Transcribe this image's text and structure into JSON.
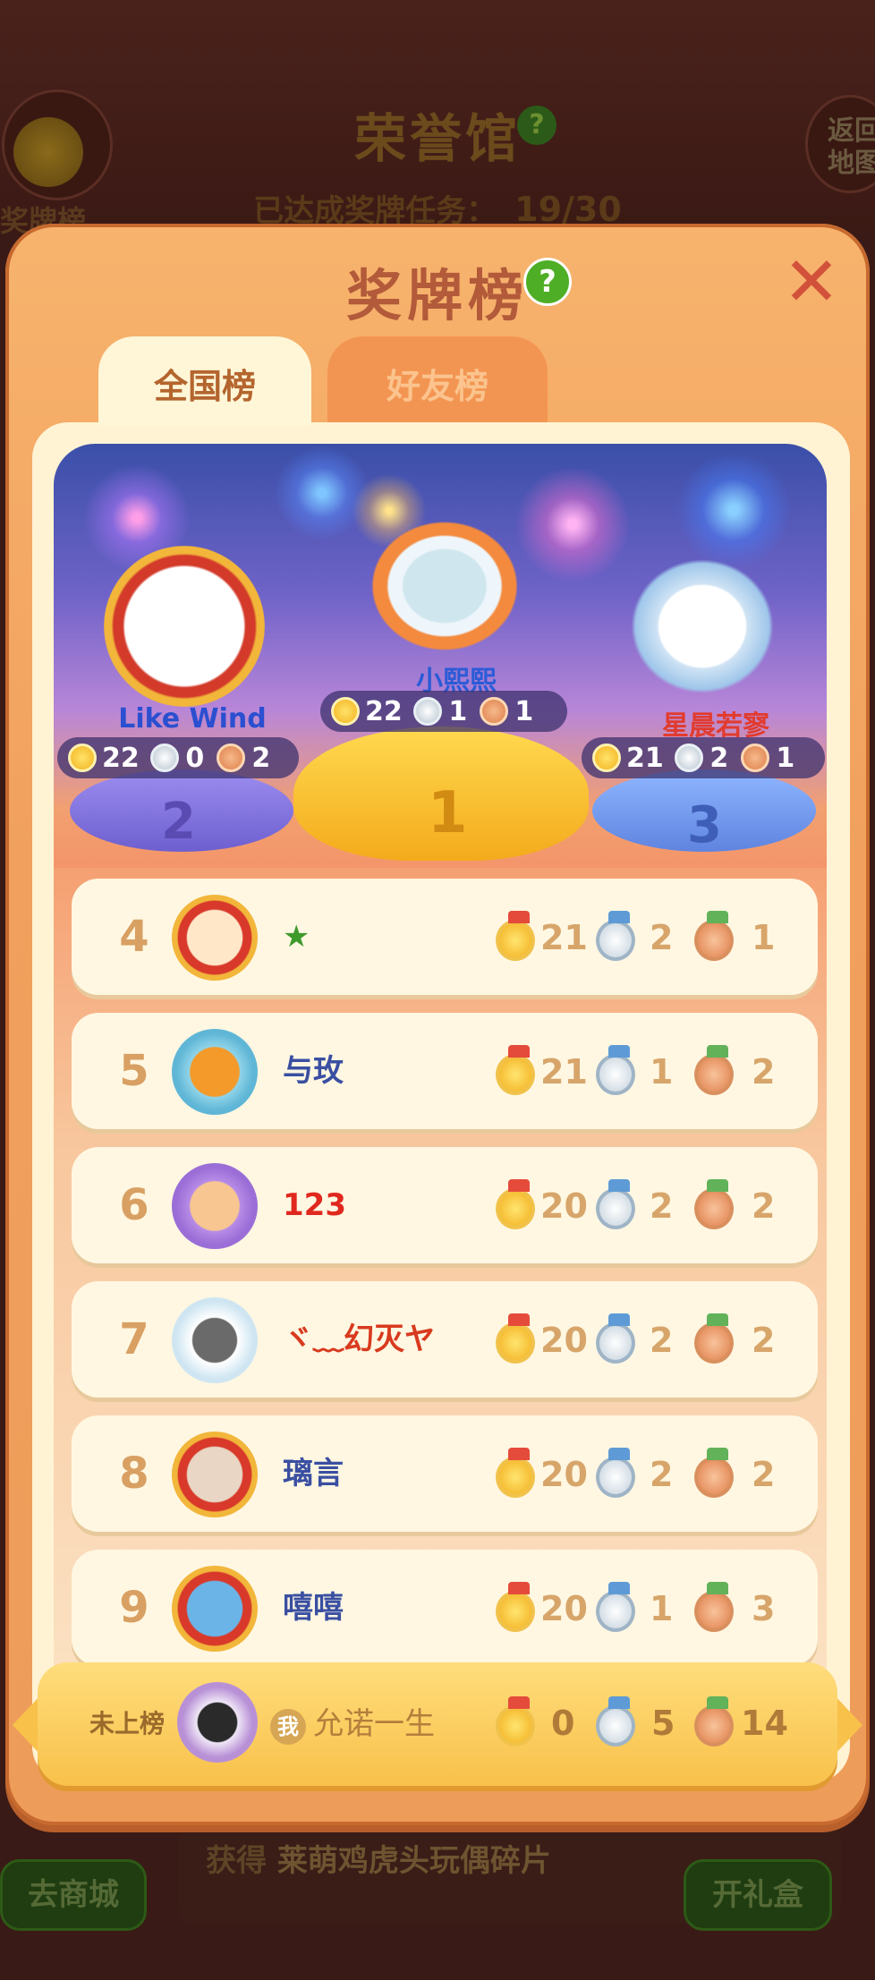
{
  "background": {
    "hall_title": "荣誉馆",
    "hall_help": "?",
    "progress_label": "已达成奖牌任务：",
    "progress_value": "19/30",
    "medal_button_label": "奖牌榜",
    "back_button_label": "返回地图",
    "reward_prefix": "获得",
    "reward_item": "莱萌鸡虎头玩偶碎片",
    "shop_button": "去商城",
    "gift_button": "开礼盒"
  },
  "modal": {
    "title": "奖牌榜",
    "help": "?",
    "close": "✕",
    "tabs": [
      {
        "label": "全国榜",
        "active": true
      },
      {
        "label": "好友榜",
        "active": false
      }
    ]
  },
  "podium": [
    {
      "rank": "1",
      "name": "小熙熙",
      "gold": "22",
      "silver": "1",
      "bronze": "1",
      "name_color": "#2a5bd7"
    },
    {
      "rank": "2",
      "name": "Like Wind",
      "gold": "22",
      "silver": "0",
      "bronze": "2",
      "name_color": "#2a4fd0"
    },
    {
      "rank": "3",
      "name": "星晨若寥",
      "gold": "21",
      "silver": "2",
      "bronze": "1",
      "name_color": "#e23b2e"
    }
  ],
  "rows": [
    {
      "rank": "4",
      "name": "★",
      "gold": "21",
      "silver": "2",
      "bronze": "1",
      "name_color": "#3f9a2c"
    },
    {
      "rank": "5",
      "name": "与玫",
      "gold": "21",
      "silver": "1",
      "bronze": "2",
      "name_color": "#3a4fa2"
    },
    {
      "rank": "6",
      "name": "123",
      "gold": "20",
      "silver": "2",
      "bronze": "2",
      "name_color": "#e0281e"
    },
    {
      "rank": "7",
      "name": "ヾ﹏幻灭ヤ",
      "gold": "20",
      "silver": "2",
      "bronze": "2",
      "name_color": "#d83a1e"
    },
    {
      "rank": "8",
      "name": "璃言",
      "gold": "20",
      "silver": "2",
      "bronze": "2",
      "name_color": "#3a4fa2"
    },
    {
      "rank": "9",
      "name": "嘻嘻",
      "gold": "20",
      "silver": "1",
      "bronze": "3",
      "name_color": "#3a4fa2"
    }
  ],
  "self": {
    "status": "未上榜",
    "badge": "我",
    "name": "允诺一生",
    "gold": "0",
    "silver": "5",
    "bronze": "14"
  },
  "colors": {
    "modal": "#f3a662",
    "panel": "#fff3d4",
    "row": "#fff7e2",
    "rank_number": "#d8a062",
    "count": "#d7a56a"
  }
}
